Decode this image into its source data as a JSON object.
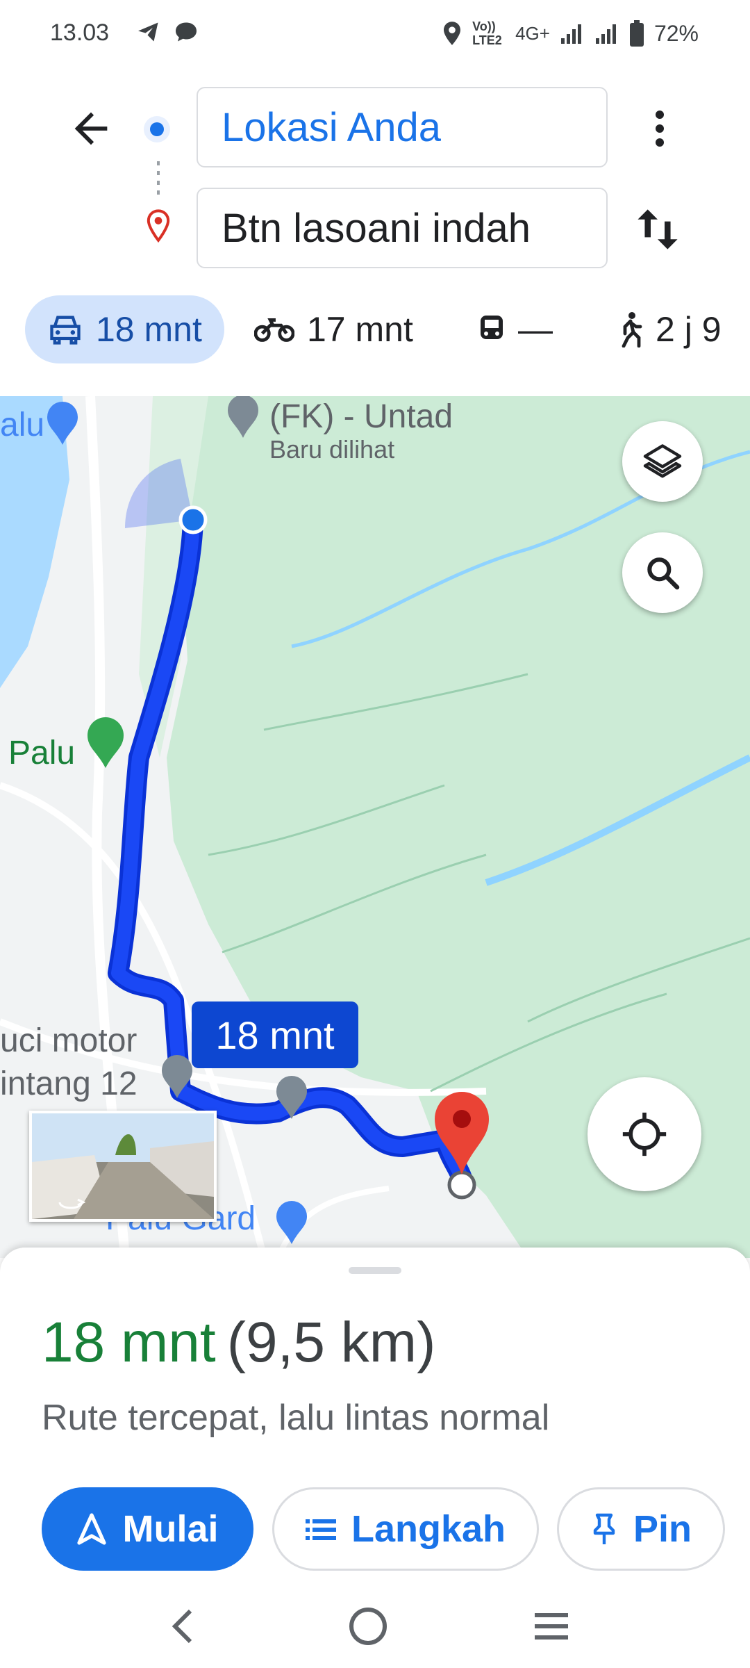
{
  "status_bar": {
    "time": "13.03",
    "network": "4G+",
    "volte": "Vo)) LTE2",
    "battery": "72%"
  },
  "directions": {
    "origin": "Lokasi Anda",
    "destination": "Btn lasoani indah"
  },
  "travel_modes": [
    {
      "mode": "car",
      "label": "18 mnt",
      "active": true
    },
    {
      "mode": "motorcycle",
      "label": "17 mnt"
    },
    {
      "mode": "transit",
      "label": "—"
    },
    {
      "mode": "walk",
      "label": "2 j 9"
    }
  ],
  "map": {
    "poi_fk": "(FK) - Untad",
    "poi_fk_sub": "Baru dilihat",
    "poi_palu": "Palu",
    "poi_palu_left": "alu",
    "poi_motor_1": "uci motor",
    "poi_motor_2": "intang 12",
    "poi_bottom": "Palu Gard",
    "eta_bubble": "18 mnt",
    "route_color": "#1a3cf0"
  },
  "summary": {
    "time": "18 mnt",
    "distance": "(9,5 km)",
    "description": "Rute tercepat, lalu lintas normal"
  },
  "actions": {
    "start": "Mulai",
    "steps": "Langkah",
    "pin": "Pin"
  },
  "colors": {
    "accent": "#1a73e8",
    "eta_green": "#188038",
    "pin_red": "#ea4335"
  }
}
